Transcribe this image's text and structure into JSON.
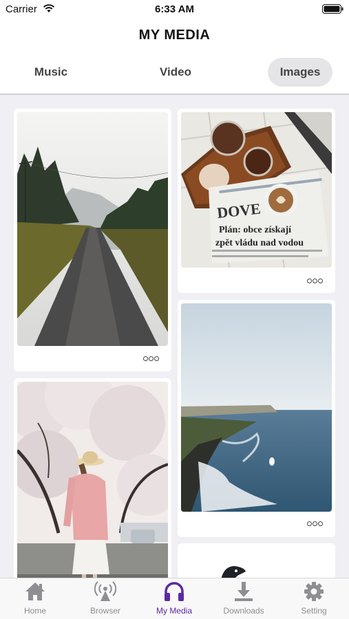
{
  "status": {
    "carrier": "Carrier",
    "time": "6:33 AM"
  },
  "header": {
    "title": "MY MEDIA"
  },
  "segments": [
    {
      "label": "Music",
      "selected": false
    },
    {
      "label": "Video",
      "selected": false
    },
    {
      "label": "Images",
      "selected": true
    }
  ],
  "gallery": {
    "items": [
      {
        "subject": "misty country road",
        "more_icon": "more-dots-icon"
      },
      {
        "subject": "coffee and newspaper",
        "more_icon": "more-dots-icon"
      },
      {
        "subject": "woman under cherry blossoms",
        "more_icon": "more-dots-icon"
      },
      {
        "subject": "coastal cliffs and ocean",
        "more_icon": "more-dots-icon"
      },
      {
        "subject": "bird",
        "more_icon": "more-dots-icon"
      }
    ],
    "newspaper_text": {
      "masthead": "DOVE",
      "headline_1": "Plán: obce získají",
      "headline_2": "zpět vládu nad vodou"
    }
  },
  "tabbar": {
    "items": [
      {
        "label": "Home",
        "icon": "home-icon",
        "active": false
      },
      {
        "label": "Browser",
        "icon": "antenna-icon",
        "active": false
      },
      {
        "label": "My Media",
        "icon": "headphones-icon",
        "active": true
      },
      {
        "label": "Downloads",
        "icon": "download-icon",
        "active": false
      },
      {
        "label": "Setting",
        "icon": "gear-icon",
        "active": false
      }
    ]
  },
  "colors": {
    "accent": "#5b2aa0",
    "inactive": "#8e8e93",
    "background": "#efeff4"
  }
}
